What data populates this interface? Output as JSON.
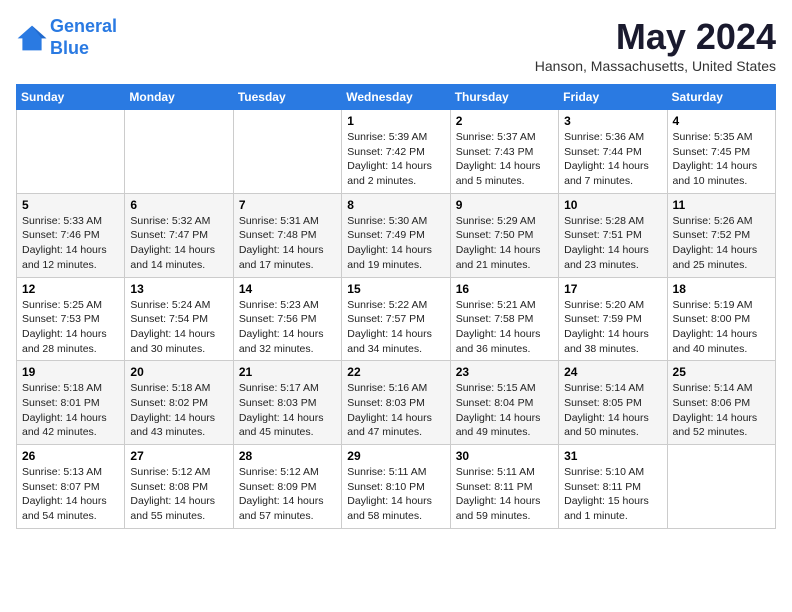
{
  "logo": {
    "line1": "General",
    "line2": "Blue"
  },
  "title": "May 2024",
  "location": "Hanson, Massachusetts, United States",
  "days_of_week": [
    "Sunday",
    "Monday",
    "Tuesday",
    "Wednesday",
    "Thursday",
    "Friday",
    "Saturday"
  ],
  "weeks": [
    [
      {
        "day": "",
        "info": ""
      },
      {
        "day": "",
        "info": ""
      },
      {
        "day": "",
        "info": ""
      },
      {
        "day": "1",
        "info": "Sunrise: 5:39 AM\nSunset: 7:42 PM\nDaylight: 14 hours\nand 2 minutes."
      },
      {
        "day": "2",
        "info": "Sunrise: 5:37 AM\nSunset: 7:43 PM\nDaylight: 14 hours\nand 5 minutes."
      },
      {
        "day": "3",
        "info": "Sunrise: 5:36 AM\nSunset: 7:44 PM\nDaylight: 14 hours\nand 7 minutes."
      },
      {
        "day": "4",
        "info": "Sunrise: 5:35 AM\nSunset: 7:45 PM\nDaylight: 14 hours\nand 10 minutes."
      }
    ],
    [
      {
        "day": "5",
        "info": "Sunrise: 5:33 AM\nSunset: 7:46 PM\nDaylight: 14 hours\nand 12 minutes."
      },
      {
        "day": "6",
        "info": "Sunrise: 5:32 AM\nSunset: 7:47 PM\nDaylight: 14 hours\nand 14 minutes."
      },
      {
        "day": "7",
        "info": "Sunrise: 5:31 AM\nSunset: 7:48 PM\nDaylight: 14 hours\nand 17 minutes."
      },
      {
        "day": "8",
        "info": "Sunrise: 5:30 AM\nSunset: 7:49 PM\nDaylight: 14 hours\nand 19 minutes."
      },
      {
        "day": "9",
        "info": "Sunrise: 5:29 AM\nSunset: 7:50 PM\nDaylight: 14 hours\nand 21 minutes."
      },
      {
        "day": "10",
        "info": "Sunrise: 5:28 AM\nSunset: 7:51 PM\nDaylight: 14 hours\nand 23 minutes."
      },
      {
        "day": "11",
        "info": "Sunrise: 5:26 AM\nSunset: 7:52 PM\nDaylight: 14 hours\nand 25 minutes."
      }
    ],
    [
      {
        "day": "12",
        "info": "Sunrise: 5:25 AM\nSunset: 7:53 PM\nDaylight: 14 hours\nand 28 minutes."
      },
      {
        "day": "13",
        "info": "Sunrise: 5:24 AM\nSunset: 7:54 PM\nDaylight: 14 hours\nand 30 minutes."
      },
      {
        "day": "14",
        "info": "Sunrise: 5:23 AM\nSunset: 7:56 PM\nDaylight: 14 hours\nand 32 minutes."
      },
      {
        "day": "15",
        "info": "Sunrise: 5:22 AM\nSunset: 7:57 PM\nDaylight: 14 hours\nand 34 minutes."
      },
      {
        "day": "16",
        "info": "Sunrise: 5:21 AM\nSunset: 7:58 PM\nDaylight: 14 hours\nand 36 minutes."
      },
      {
        "day": "17",
        "info": "Sunrise: 5:20 AM\nSunset: 7:59 PM\nDaylight: 14 hours\nand 38 minutes."
      },
      {
        "day": "18",
        "info": "Sunrise: 5:19 AM\nSunset: 8:00 PM\nDaylight: 14 hours\nand 40 minutes."
      }
    ],
    [
      {
        "day": "19",
        "info": "Sunrise: 5:18 AM\nSunset: 8:01 PM\nDaylight: 14 hours\nand 42 minutes."
      },
      {
        "day": "20",
        "info": "Sunrise: 5:18 AM\nSunset: 8:02 PM\nDaylight: 14 hours\nand 43 minutes."
      },
      {
        "day": "21",
        "info": "Sunrise: 5:17 AM\nSunset: 8:03 PM\nDaylight: 14 hours\nand 45 minutes."
      },
      {
        "day": "22",
        "info": "Sunrise: 5:16 AM\nSunset: 8:03 PM\nDaylight: 14 hours\nand 47 minutes."
      },
      {
        "day": "23",
        "info": "Sunrise: 5:15 AM\nSunset: 8:04 PM\nDaylight: 14 hours\nand 49 minutes."
      },
      {
        "day": "24",
        "info": "Sunrise: 5:14 AM\nSunset: 8:05 PM\nDaylight: 14 hours\nand 50 minutes."
      },
      {
        "day": "25",
        "info": "Sunrise: 5:14 AM\nSunset: 8:06 PM\nDaylight: 14 hours\nand 52 minutes."
      }
    ],
    [
      {
        "day": "26",
        "info": "Sunrise: 5:13 AM\nSunset: 8:07 PM\nDaylight: 14 hours\nand 54 minutes."
      },
      {
        "day": "27",
        "info": "Sunrise: 5:12 AM\nSunset: 8:08 PM\nDaylight: 14 hours\nand 55 minutes."
      },
      {
        "day": "28",
        "info": "Sunrise: 5:12 AM\nSunset: 8:09 PM\nDaylight: 14 hours\nand 57 minutes."
      },
      {
        "day": "29",
        "info": "Sunrise: 5:11 AM\nSunset: 8:10 PM\nDaylight: 14 hours\nand 58 minutes."
      },
      {
        "day": "30",
        "info": "Sunrise: 5:11 AM\nSunset: 8:11 PM\nDaylight: 14 hours\nand 59 minutes."
      },
      {
        "day": "31",
        "info": "Sunrise: 5:10 AM\nSunset: 8:11 PM\nDaylight: 15 hours\nand 1 minute."
      },
      {
        "day": "",
        "info": ""
      }
    ]
  ]
}
